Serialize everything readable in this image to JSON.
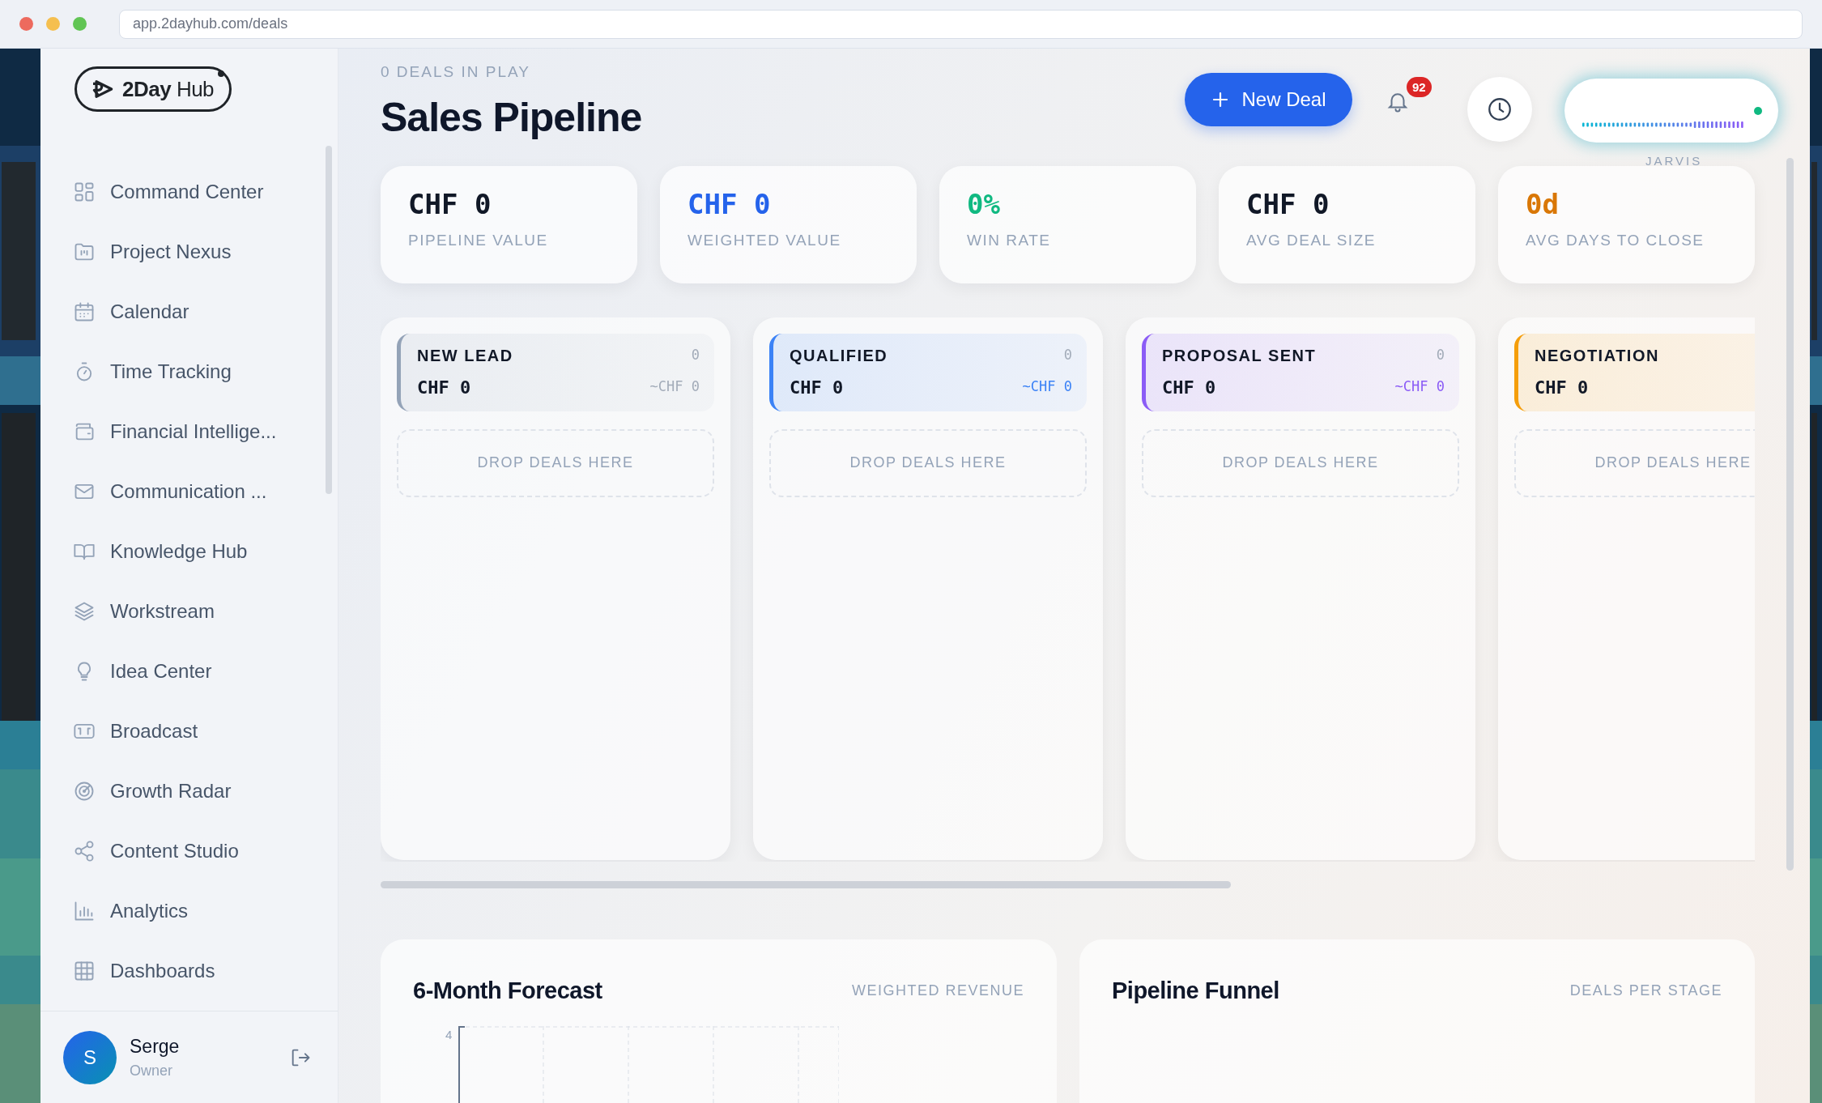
{
  "browser": {
    "url": "app.2dayhub.com/deals"
  },
  "sidebar": {
    "logo": {
      "bold": "2Day",
      "light": "Hub"
    },
    "items": [
      {
        "label": "Command Center"
      },
      {
        "label": "Project Nexus"
      },
      {
        "label": "Calendar"
      },
      {
        "label": "Time Tracking"
      },
      {
        "label": "Financial Intellige..."
      },
      {
        "label": "Communication ..."
      },
      {
        "label": "Knowledge Hub"
      },
      {
        "label": "Workstream"
      },
      {
        "label": "Idea Center"
      },
      {
        "label": "Broadcast"
      },
      {
        "label": "Growth Radar"
      },
      {
        "label": "Content Studio"
      },
      {
        "label": "Analytics"
      },
      {
        "label": "Dashboards"
      }
    ],
    "user": {
      "initial": "S",
      "name": "Serge",
      "role": "Owner"
    }
  },
  "header": {
    "eyebrow": "0 DEALS IN PLAY",
    "title": "Sales Pipeline",
    "new_button": "New Deal",
    "notifications": "92",
    "assistant": {
      "label": "JARVIS",
      "online": true
    }
  },
  "stats": [
    {
      "value": "CHF 0",
      "label": "PIPELINE VALUE",
      "color": "#111827"
    },
    {
      "value": "CHF 0",
      "label": "WEIGHTED VALUE",
      "color": "#2563eb"
    },
    {
      "value": "0%",
      "label": "WIN RATE",
      "color": "#10b981"
    },
    {
      "value": "CHF 0",
      "label": "AVG DEAL SIZE",
      "color": "#111827"
    },
    {
      "value": "0d",
      "label": "AVG DAYS TO CLOSE",
      "color": "#d97706"
    }
  ],
  "stages": [
    {
      "name": "NEW LEAD",
      "count": "0",
      "total": "CHF 0",
      "weighted": "~CHF 0",
      "color": "#94a3b8",
      "drop": "DROP DEALS HERE"
    },
    {
      "name": "QUALIFIED",
      "count": "0",
      "total": "CHF 0",
      "weighted": "~CHF 0",
      "color": "#3b82f6",
      "drop": "DROP DEALS HERE"
    },
    {
      "name": "PROPOSAL SENT",
      "count": "0",
      "total": "CHF 0",
      "weighted": "~CHF 0",
      "color": "#8b5cf6",
      "drop": "DROP DEALS HERE"
    },
    {
      "name": "NEGOTIATION",
      "total": "CHF 0",
      "color": "#f59e0b",
      "drop": "DROP DEALS HERE"
    }
  ],
  "panels": [
    {
      "title": "6-Month Forecast",
      "subtitle": "WEIGHTED REVENUE",
      "y_tick": "4"
    },
    {
      "title": "Pipeline Funnel",
      "subtitle": "DEALS PER STAGE"
    }
  ]
}
